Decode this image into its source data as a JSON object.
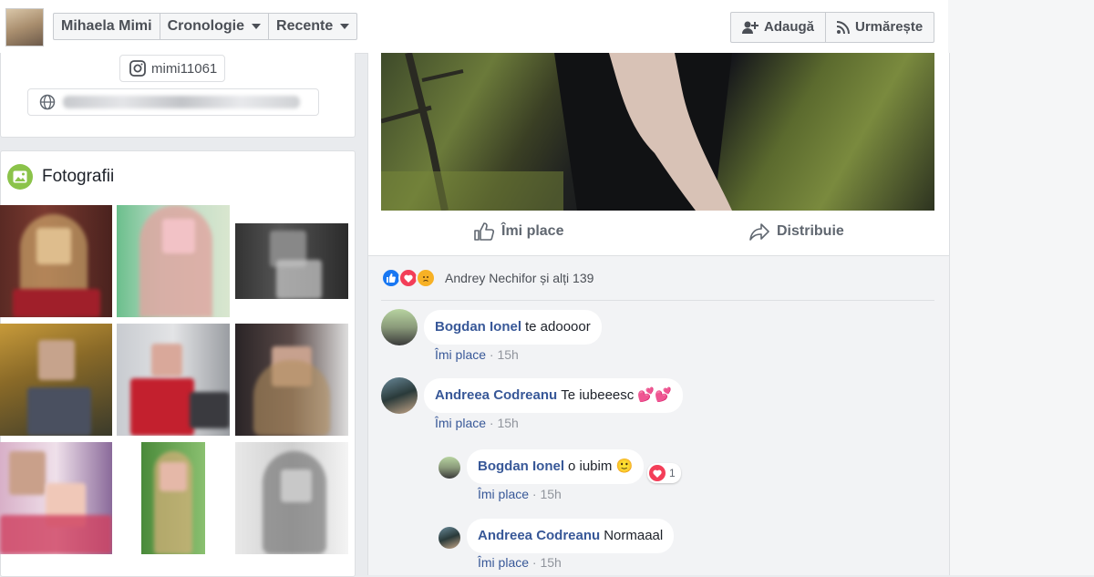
{
  "header": {
    "profile_name": "Mihaela Mimi",
    "timeline_label": "Cronologie",
    "recent_label": "Recente",
    "add_label": "Adaugă",
    "follow_label": "Urmărește"
  },
  "intro": {
    "instagram_handle": "mimi11061"
  },
  "photos": {
    "title": "Fotografii"
  },
  "post": {
    "like_label": "Îmi place",
    "share_label": "Distribuie",
    "reactions_text": "Andrey Nechifor și alți 139"
  },
  "comments": [
    {
      "author": "Bogdan Ionel",
      "text": "te adoooor",
      "like_label": "Îmi place",
      "time": "15h"
    },
    {
      "author": "Andreea Codreanu",
      "text": "Te iubeeesc 💕💕",
      "like_label": "Îmi place",
      "time": "15h"
    },
    {
      "author": "Bogdan Ionel",
      "text": "o iubim 🙂",
      "like_label": "Îmi place",
      "time": "15h",
      "reaction_count": "1"
    },
    {
      "author": "Andreea Codreanu",
      "text": "Normaaal",
      "like_label": "Îmi place",
      "time": "15h"
    }
  ],
  "colors": {
    "link_blue": "#385898",
    "page_bg": "#e9ebee",
    "like_blue": "#1877f2",
    "love_red": "#f33e58",
    "sad_yellow": "#f7b125"
  }
}
